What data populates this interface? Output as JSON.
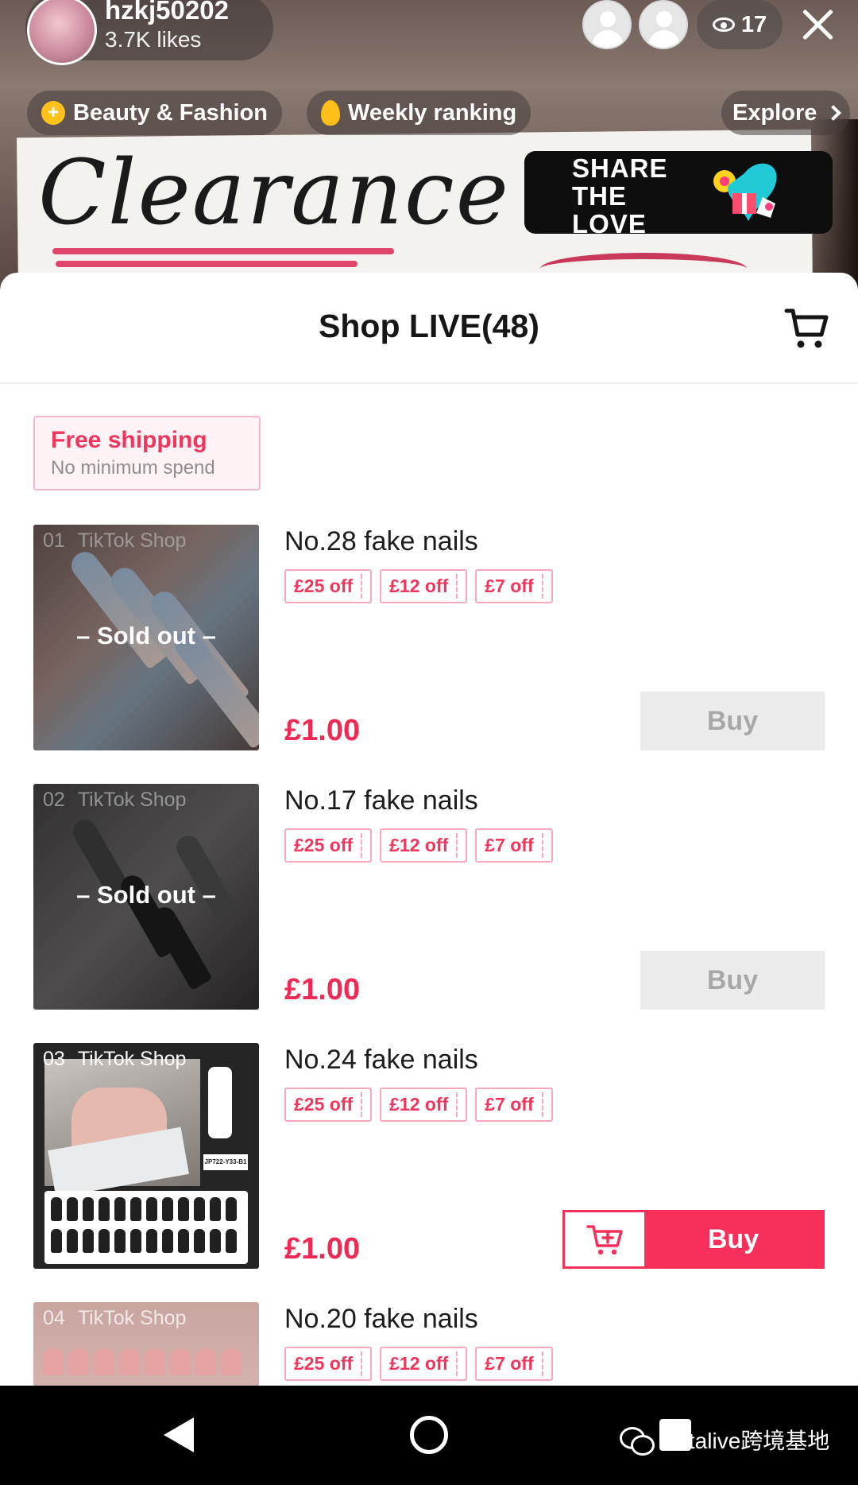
{
  "live": {
    "host_name": "hzkj50202",
    "host_likes": "3.7K likes",
    "viewer_count": "17",
    "chips": {
      "category": "Beauty & Fashion",
      "ranking": "Weekly ranking",
      "explore": "Explore"
    },
    "sign_text": "Clearance Sale",
    "banner_text": "SHARE THE LOVE"
  },
  "sheet": {
    "title": "Shop LIVE(48)",
    "shipping": {
      "title": "Free shipping",
      "subtitle": "No minimum spend"
    },
    "items": [
      {
        "index": "01",
        "source": "TikTok Shop",
        "title": "No.28 fake nails",
        "coupons": [
          "£25 off",
          "£12 off",
          "£7 off"
        ],
        "price": "£1.00",
        "status": "– Sold out –",
        "button": "Buy"
      },
      {
        "index": "02",
        "source": "TikTok Shop",
        "title": "No.17 fake nails",
        "coupons": [
          "£25 off",
          "£12 off",
          "£7 off"
        ],
        "price": "£1.00",
        "status": "– Sold out –",
        "button": "Buy"
      },
      {
        "index": "03",
        "source": "TikTok Shop",
        "title": "No.24 fake nails",
        "coupons": [
          "£25 off",
          "£12 off",
          "£7 off"
        ],
        "price": "£1.00",
        "button": "Buy",
        "product_code": "JP722-Y33-B1"
      },
      {
        "index": "04",
        "source": "TikTok Shop",
        "title": "No.20 fake nails",
        "coupons": [
          "£25 off",
          "£12 off",
          "£7 off"
        ]
      }
    ]
  },
  "watermark": "Metalive跨境基地",
  "colors": {
    "accent": "#f6305a",
    "price": "#ee2a55",
    "disabled_button": "#ececec"
  }
}
